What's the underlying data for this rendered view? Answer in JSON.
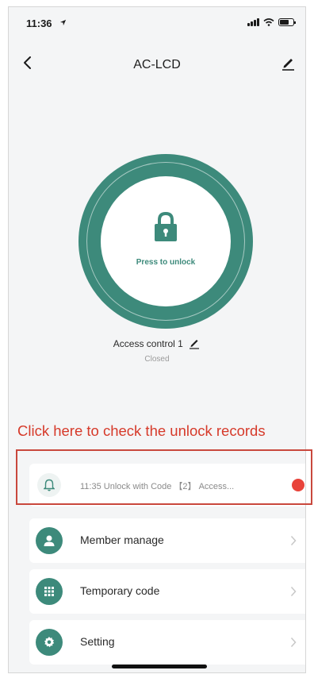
{
  "status_bar": {
    "time": "11:36"
  },
  "nav": {
    "title": "AC-LCD"
  },
  "lock": {
    "press_label": "Press to unlock"
  },
  "device": {
    "name": "Access control 1",
    "status": "Closed"
  },
  "annotation": {
    "text": "Click here to check the unlock records"
  },
  "record": {
    "text": "11:35  Unlock with Code 【2】 Access...",
    "badge": ""
  },
  "menu": [
    {
      "label": "Member manage",
      "icon": "person-icon"
    },
    {
      "label": "Temporary code",
      "icon": "keypad-icon"
    },
    {
      "label": "Setting",
      "icon": "gear-icon"
    }
  ],
  "colors": {
    "accent": "#3d8a7b",
    "annotation": "#d63a2a",
    "badge": "#e8433a"
  }
}
